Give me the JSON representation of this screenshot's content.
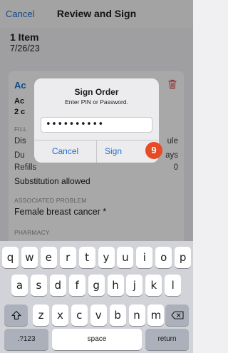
{
  "nav": {
    "cancel_label": "Cancel",
    "title": "Review and Sign"
  },
  "summary": {
    "count": "1 Item",
    "date": "7/26/23"
  },
  "card": {
    "header": "Ac",
    "line1": "Ac",
    "line2": "2 c",
    "fill_section": "FILL",
    "dispense_label": "Dis",
    "dispense_value": "ule",
    "duration_label": "Du",
    "duration_value": "ays",
    "refills_label": "Refills",
    "refills_value": "0",
    "substitution": "Substitution allowed",
    "problem_section": "ASSOCIATED PROBLEM",
    "problem_value": "Female breast cancer *",
    "pharmacy_section": "PHARMACY"
  },
  "dialog": {
    "title": "Sign Order",
    "message": "Enter PIN or Password.",
    "pin_value": "••••••••••",
    "cancel_label": "Cancel",
    "sign_label": "Sign"
  },
  "step_badge": "9",
  "keyboard": {
    "row1": [
      "q",
      "w",
      "e",
      "r",
      "t",
      "y",
      "u",
      "i",
      "o",
      "p"
    ],
    "row2": [
      "a",
      "s",
      "d",
      "f",
      "g",
      "h",
      "j",
      "k",
      "l"
    ],
    "row3": [
      "z",
      "x",
      "c",
      "v",
      "b",
      "n",
      "m"
    ],
    "numbers_label": ".?123",
    "space_label": "space",
    "return_label": "return"
  },
  "colors": {
    "accent": "#1f6fd1",
    "badge": "#e74a24",
    "trash": "#d9534f"
  }
}
